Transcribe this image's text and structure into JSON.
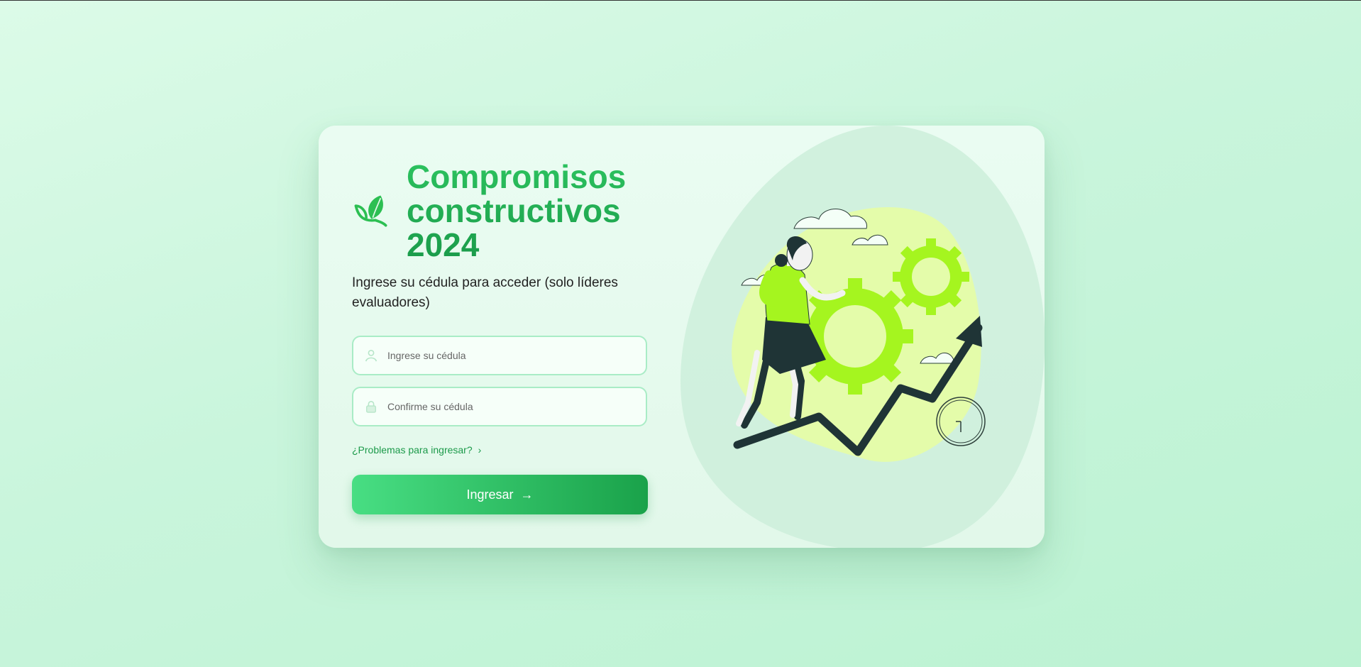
{
  "brand": {
    "title": "Compromisos constructivos 2024",
    "icon": "leaf-icon",
    "color": "#22b157"
  },
  "login": {
    "subtitle": "Ingrese su cédula para acceder (solo líderes evaluadores)",
    "cedula_placeholder": "Ingrese su cédula",
    "confirm_placeholder": "Confirme su cédula",
    "help_link": "¿Problemas para ingresar?",
    "submit_label": "Ingresar",
    "accent": "#1aa24a"
  },
  "illustration": {
    "description_icon": "growth-illustration"
  }
}
